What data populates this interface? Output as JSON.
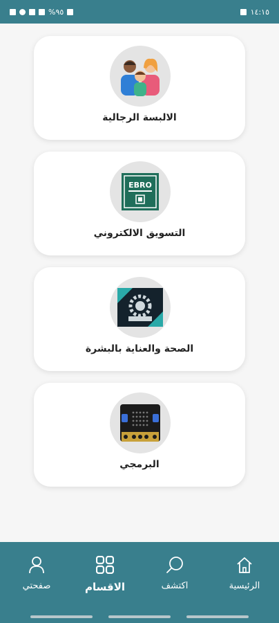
{
  "status_bar": {
    "time": "١٤:١٥",
    "battery": "%٩٥"
  },
  "categories": [
    {
      "label": "الالبسة الرجالية",
      "icon": "family-icon"
    },
    {
      "label": "التسويق الالكتروني",
      "icon": "ebro-logo-icon",
      "logo_text": "EBRO"
    },
    {
      "label": "الصحة والعناية بالبشرة",
      "icon": "gear-emblem-icon"
    },
    {
      "label": "البرمجي",
      "icon": "microbit-board-icon"
    }
  ],
  "bottom_nav": {
    "home": "الرئيسية",
    "explore": "اكتشف",
    "sections": "الاقسام",
    "my_page": "صفحتي"
  },
  "colors": {
    "primary": "#397f8d",
    "background": "#f6f6f6",
    "card": "#ffffff"
  }
}
